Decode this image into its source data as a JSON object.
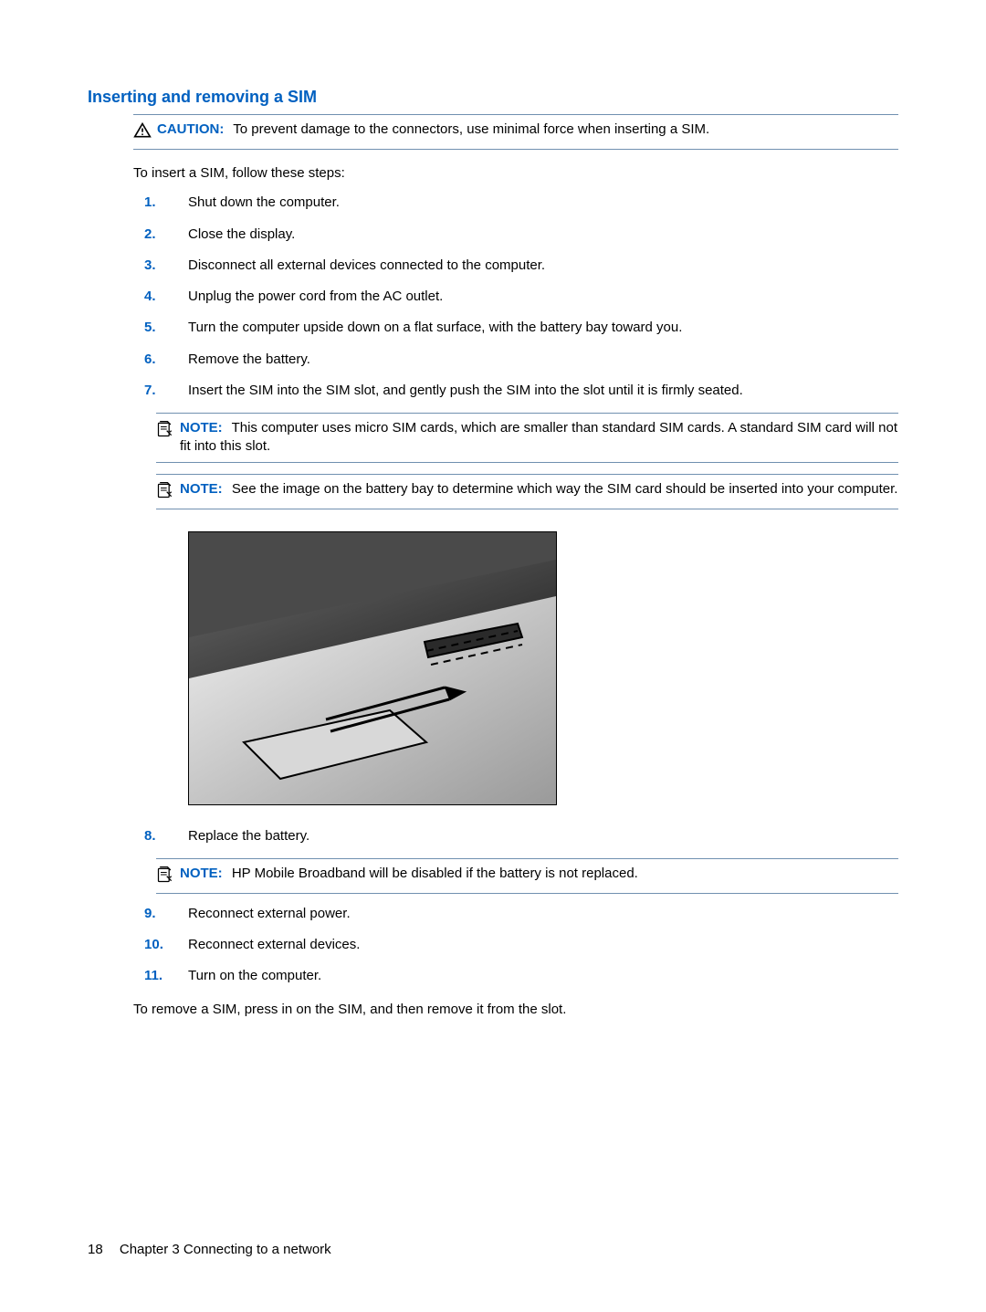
{
  "heading": "Inserting and removing a SIM",
  "labels": {
    "caution": "CAUTION:",
    "note": "NOTE:"
  },
  "caution_text": "To prevent damage to the connectors, use minimal force when inserting a SIM.",
  "intro": "To insert a SIM, follow these steps:",
  "steps_a": [
    "Shut down the computer.",
    "Close the display.",
    "Disconnect all external devices connected to the computer.",
    "Unplug the power cord from the AC outlet.",
    "Turn the computer upside down on a flat surface, with the battery bay toward you.",
    "Remove the battery.",
    "Insert the SIM into the SIM slot, and gently push the SIM into the slot until it is firmly seated."
  ],
  "note1_text": "This computer uses micro SIM cards, which are smaller than standard SIM cards. A standard SIM card will not fit into this slot.",
  "note2_text": "See the image on the battery bay to determine which way the SIM card should be inserted into your computer.",
  "steps_b": [
    "Replace the battery."
  ],
  "note3_text": "HP Mobile Broadband will be disabled if the battery is not replaced.",
  "steps_c": [
    "Reconnect external power.",
    "Reconnect external devices.",
    "Turn on the computer."
  ],
  "outro": "To remove a SIM, press in on the SIM, and then remove it from the slot.",
  "footer": {
    "page_number": "18",
    "chapter": "Chapter 3   Connecting to a network"
  }
}
